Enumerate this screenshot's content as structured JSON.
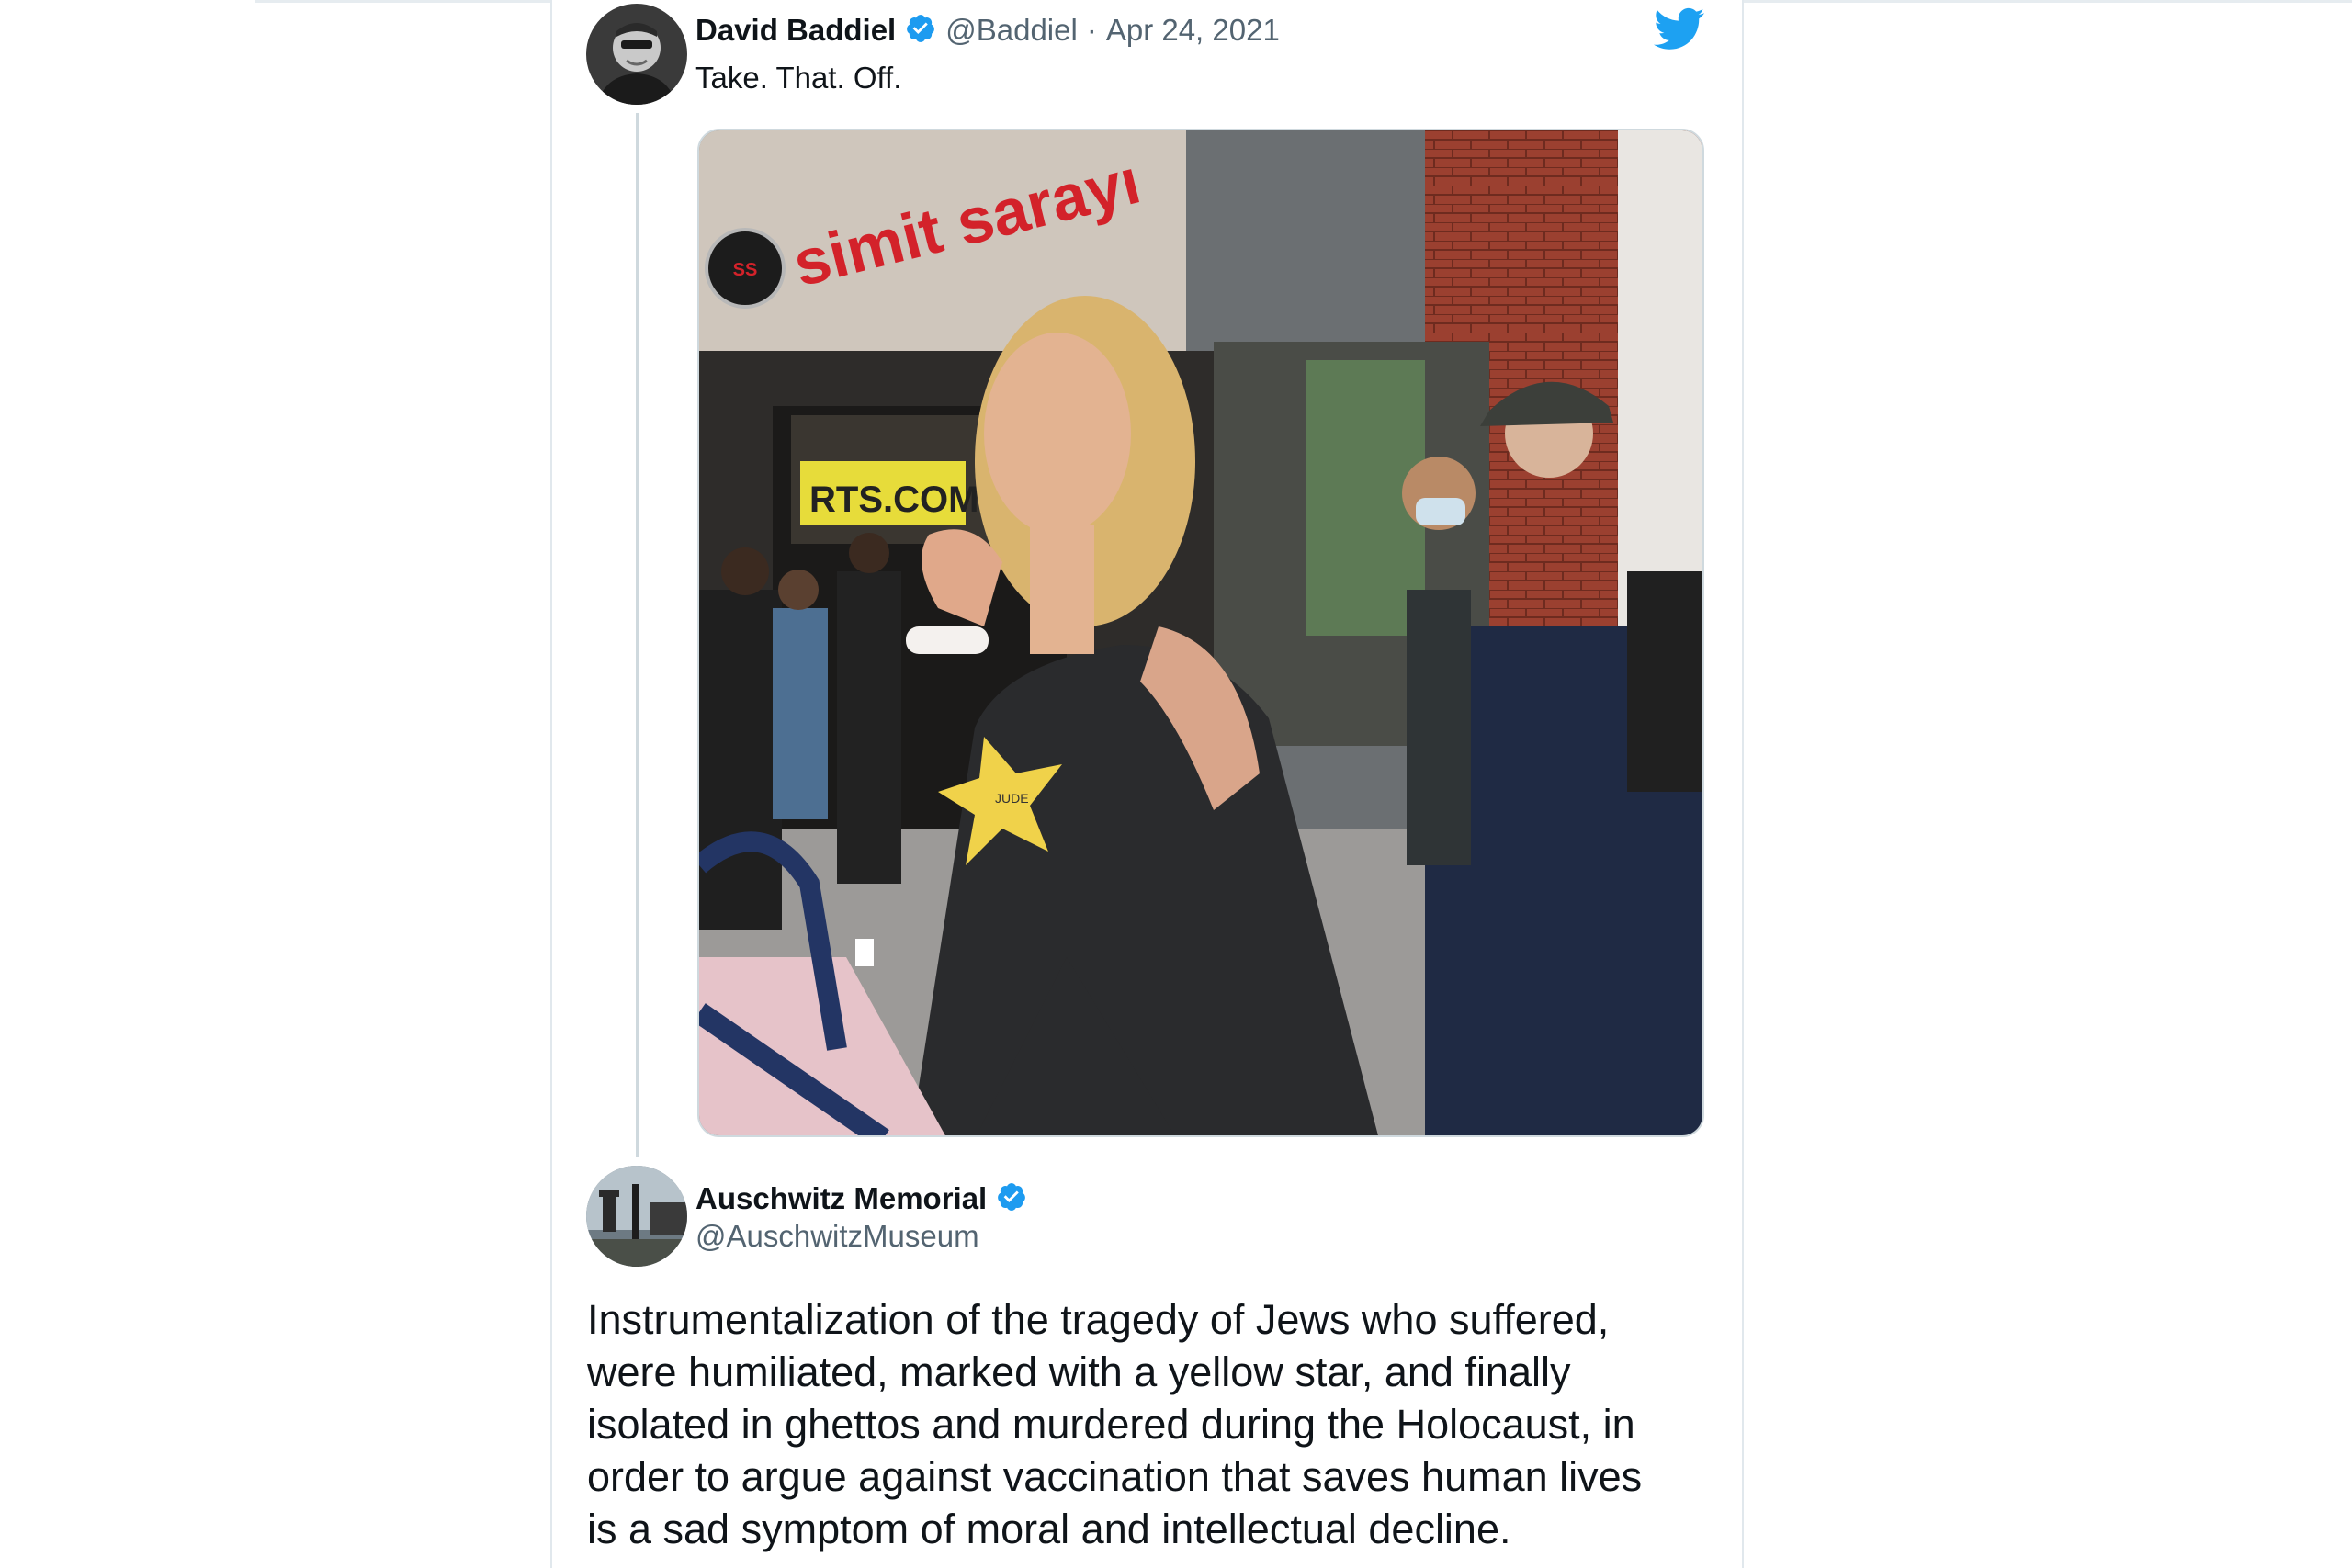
{
  "tweet1": {
    "author_name": "David Baddiel",
    "handle": "@Baddiel",
    "separator": "·",
    "date": "Apr 24, 2021",
    "text": "Take. That. Off.",
    "verified_icon": "verified-badge-icon",
    "logo_icon": "twitter-bird-icon"
  },
  "tweet2": {
    "author_name": "Auschwitz Memorial",
    "handle": "@AuschwitzMuseum",
    "verified_icon": "verified-badge-icon",
    "text_lines": [
      "Instrumentalization of the tragedy of Jews who suffered,",
      "were humiliated, marked with a yellow star, and finally",
      "isolated in ghettos and murdered during the Holocaust, in",
      "order to argue against vaccination that saves human lives",
      "is a sad symptom of moral and intellectual decline."
    ]
  },
  "photo": {
    "sign_text": "simit sarayı",
    "storefront_text": "RTS.COM",
    "star_text": "JUDE"
  },
  "colors": {
    "verified_blue": "#1d9bf0",
    "twitter_blue": "#1da1f2",
    "text": "#0f1419",
    "muted": "#536471",
    "border": "#e1e8ed",
    "brick": "#8f3a2a",
    "sign_red": "#d3222a",
    "star_yellow": "#f0d24a"
  }
}
